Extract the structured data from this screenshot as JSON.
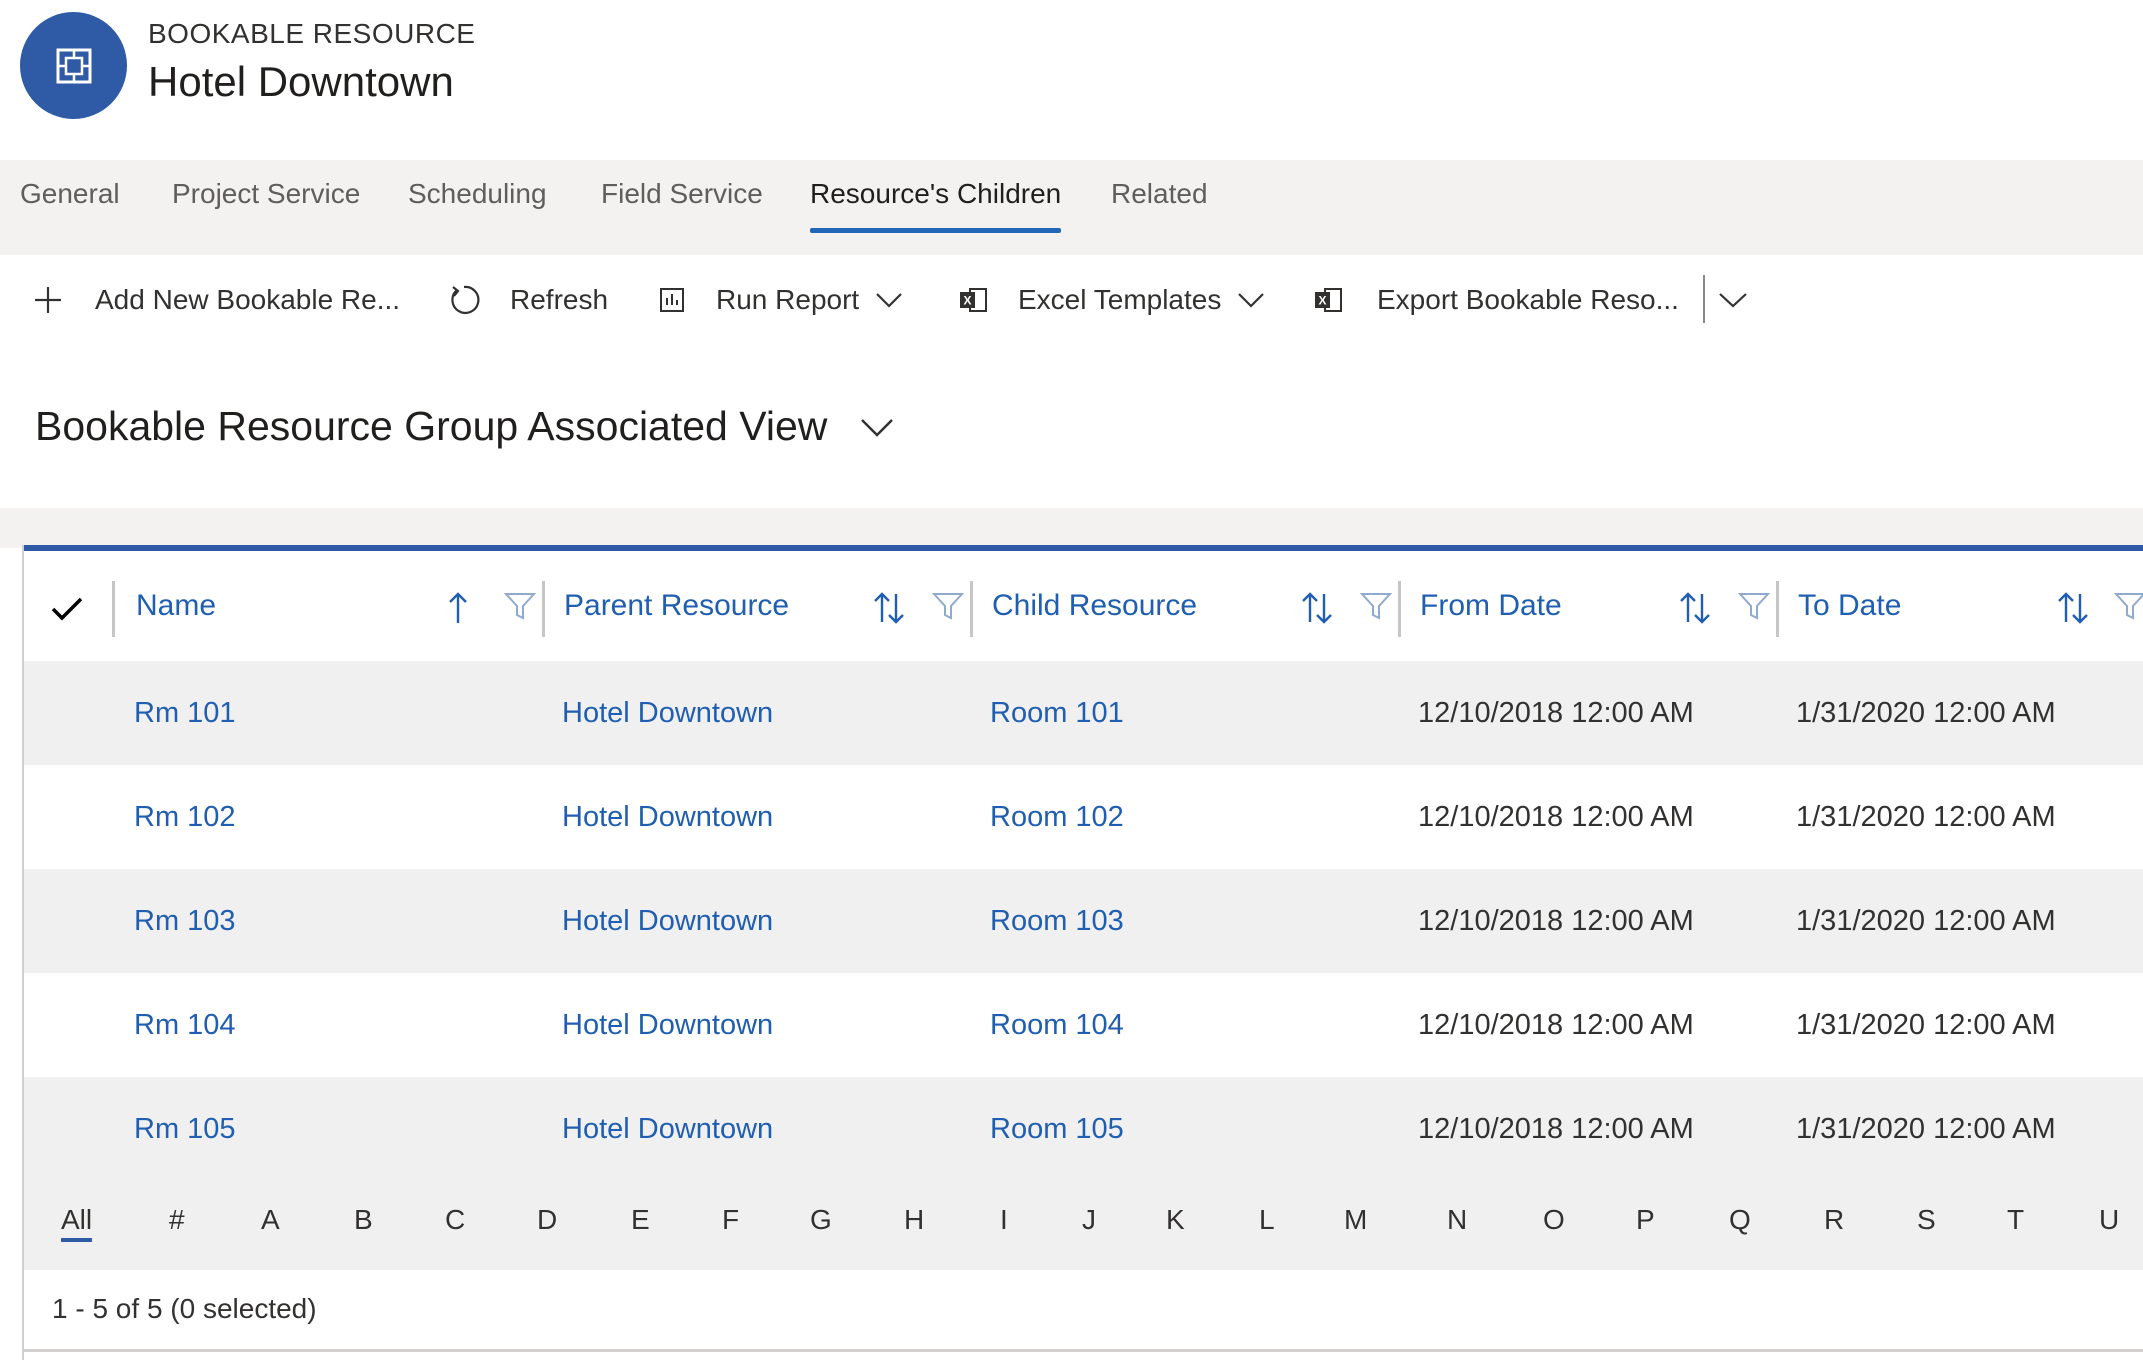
{
  "header": {
    "entity_type": "BOOKABLE RESOURCE",
    "title": "Hotel Downtown",
    "avatar_icon": "resource-icon",
    "avatar_color": "#2e5aa6"
  },
  "tabs": [
    {
      "label": "General"
    },
    {
      "label": "Project Service"
    },
    {
      "label": "Scheduling"
    },
    {
      "label": "Field Service"
    },
    {
      "label": "Resource's Children",
      "active": true
    },
    {
      "label": "Related"
    }
  ],
  "commands": {
    "add": "Add New Bookable Re...",
    "refresh": "Refresh",
    "run_report": "Run Report",
    "excel_templates": "Excel Templates",
    "export": "Export Bookable Reso..."
  },
  "view": {
    "title": "Bookable Resource Group Associated View"
  },
  "grid": {
    "columns": [
      {
        "label": "Name",
        "sort": "ascending"
      },
      {
        "label": "Parent Resource",
        "sort": "none"
      },
      {
        "label": "Child Resource",
        "sort": "none"
      },
      {
        "label": "From Date",
        "sort": "none"
      },
      {
        "label": "To Date",
        "sort": "none"
      }
    ],
    "rows": [
      {
        "name": "Rm 101",
        "parent": "Hotel Downtown",
        "child": "Room 101",
        "from": "12/10/2018 12:00 AM",
        "to": "1/31/2020 12:00 AM"
      },
      {
        "name": "Rm 102",
        "parent": "Hotel Downtown",
        "child": "Room 102",
        "from": "12/10/2018 12:00 AM",
        "to": "1/31/2020 12:00 AM"
      },
      {
        "name": "Rm 103",
        "parent": "Hotel Downtown",
        "child": "Room 103",
        "from": "12/10/2018 12:00 AM",
        "to": "1/31/2020 12:00 AM"
      },
      {
        "name": "Rm 104",
        "parent": "Hotel Downtown",
        "child": "Room 104",
        "from": "12/10/2018 12:00 AM",
        "to": "1/31/2020 12:00 AM"
      },
      {
        "name": "Rm 105",
        "parent": "Hotel Downtown",
        "child": "Room 105",
        "from": "12/10/2018 12:00 AM",
        "to": "1/31/2020 12:00 AM"
      }
    ],
    "jump_bar": [
      "All",
      "#",
      "A",
      "B",
      "C",
      "D",
      "E",
      "F",
      "G",
      "H",
      "I",
      "J",
      "K",
      "L",
      "M",
      "N",
      "O",
      "P",
      "Q",
      "R",
      "S",
      "T",
      "U"
    ],
    "status": "1 - 5 of 5 (0 selected)",
    "link_color": "#1f5eb0",
    "accent_color": "#2e5aa6"
  }
}
